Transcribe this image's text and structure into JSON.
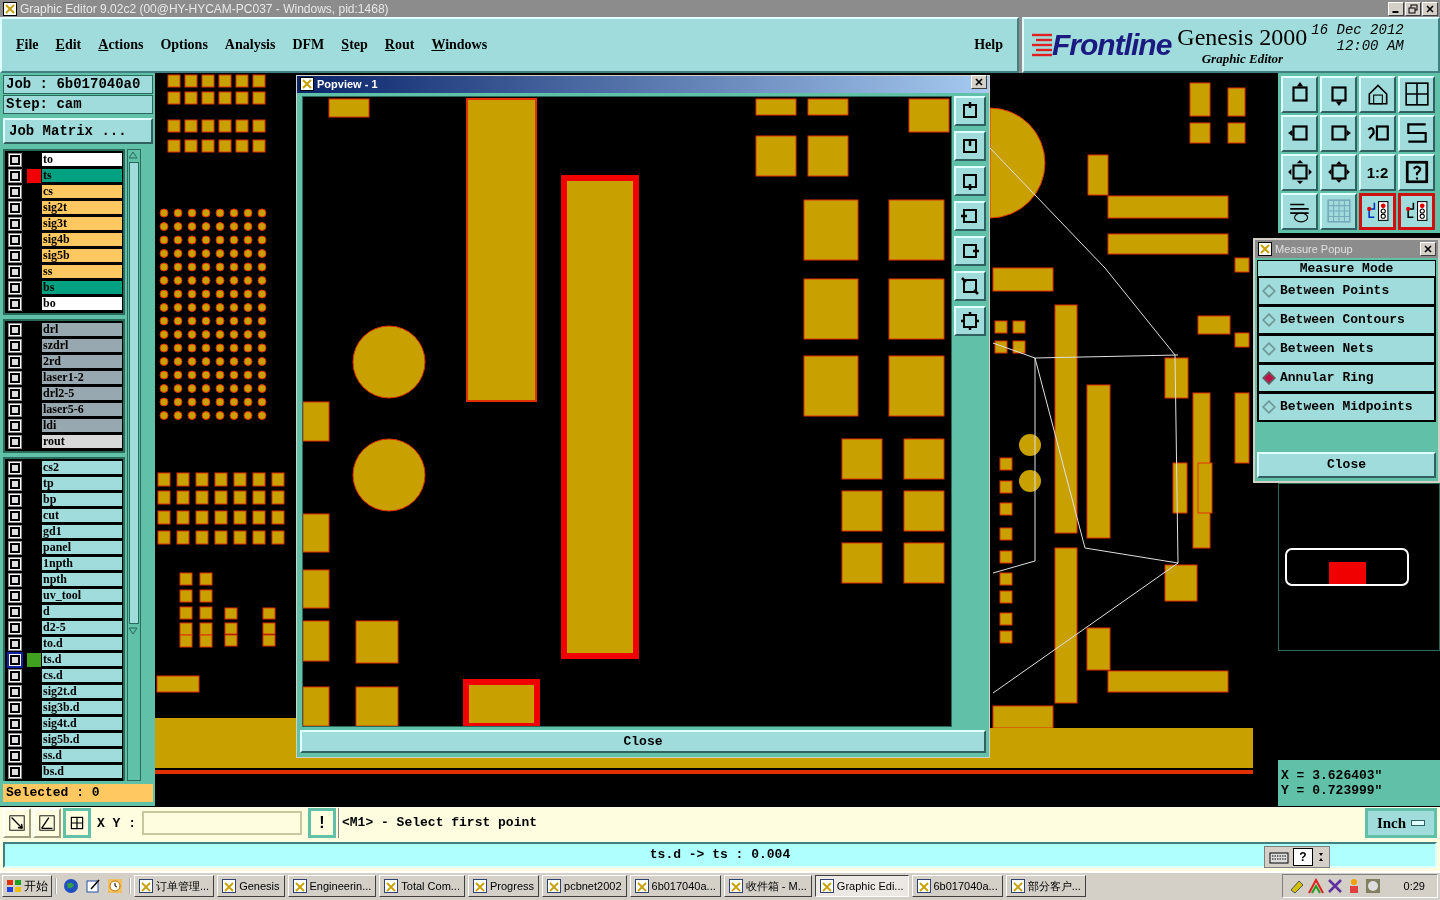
{
  "window": {
    "title": "Graphic Editor 9.02c2 (00@HY-HYCAM-PC037 - Windows, pid:1468)"
  },
  "menu": [
    {
      "label": "File",
      "mnemonic": true
    },
    {
      "label": "Edit",
      "mnemonic": true
    },
    {
      "label": "Actions",
      "mnemonic": true
    },
    {
      "label": "Options",
      "mnemonic": false
    },
    {
      "label": "Analysis",
      "mnemonic": false
    },
    {
      "label": "DFM",
      "mnemonic": false
    },
    {
      "label": "Step",
      "mnemonic": true
    },
    {
      "label": "Rout",
      "mnemonic": true
    },
    {
      "label": "Windows",
      "mnemonic": true
    }
  ],
  "help_menu": {
    "label": "Help",
    "mnemonic": false
  },
  "brand": {
    "logo": "Frontline",
    "product": "Genesis 2000",
    "subtitle": "Graphic Editor",
    "date": "16 Dec 2012",
    "time": "12:00 AM"
  },
  "job": {
    "job_label": "Job : 6b017040a0",
    "step_label": "Step: cam",
    "matrix_button": "Job Matrix ..."
  },
  "layer_groups": [
    {
      "layers": [
        {
          "name": "to",
          "color": "#ffffff",
          "work_layer": false,
          "displayed": false,
          "checked": false
        },
        {
          "name": "ts",
          "color": "#00a080",
          "work_layer": true,
          "displayed": false,
          "checked": false
        },
        {
          "name": "cs",
          "color": "#ffc860",
          "work_layer": false,
          "displayed": false,
          "checked": false
        },
        {
          "name": "sig2t",
          "color": "#ffc860",
          "work_layer": false,
          "displayed": false,
          "checked": false
        },
        {
          "name": "sig3t",
          "color": "#ffc860",
          "work_layer": false,
          "displayed": false,
          "checked": false
        },
        {
          "name": "sig4b",
          "color": "#ffc860",
          "work_layer": false,
          "displayed": false,
          "checked": false
        },
        {
          "name": "sig5b",
          "color": "#ffc860",
          "work_layer": false,
          "displayed": false,
          "checked": false
        },
        {
          "name": "ss",
          "color": "#ffc860",
          "work_layer": false,
          "displayed": false,
          "checked": false
        },
        {
          "name": "bs",
          "color": "#00a080",
          "work_layer": false,
          "displayed": false,
          "checked": false
        },
        {
          "name": "bo",
          "color": "#ffffff",
          "work_layer": false,
          "displayed": false,
          "checked": false
        }
      ]
    },
    {
      "layers": [
        {
          "name": "drl",
          "color": "#98a8b0",
          "work_layer": false,
          "displayed": false,
          "checked": false
        },
        {
          "name": "szdrl",
          "color": "#98a8b0",
          "work_layer": false,
          "displayed": false,
          "checked": false
        },
        {
          "name": "2rd",
          "color": "#98a8b0",
          "work_layer": false,
          "displayed": false,
          "checked": false
        },
        {
          "name": "laser1-2",
          "color": "#98a8b0",
          "work_layer": false,
          "displayed": false,
          "checked": false
        },
        {
          "name": "drl2-5",
          "color": "#98a8b0",
          "work_layer": false,
          "displayed": false,
          "checked": false
        },
        {
          "name": "laser5-6",
          "color": "#98a8b0",
          "work_layer": false,
          "displayed": false,
          "checked": false
        },
        {
          "name": "ldi",
          "color": "#98a8b0",
          "work_layer": false,
          "displayed": false,
          "checked": false
        },
        {
          "name": "rout",
          "color": "#d8d8d8",
          "work_layer": false,
          "displayed": false,
          "checked": false
        }
      ]
    },
    {
      "layers": [
        {
          "name": "cs2",
          "color": "#a0dcdc",
          "work_layer": false,
          "displayed": false,
          "checked": false
        },
        {
          "name": "tp",
          "color": "#a0dcdc",
          "work_layer": false,
          "displayed": false,
          "checked": false
        },
        {
          "name": "bp",
          "color": "#a0dcdc",
          "work_layer": false,
          "displayed": false,
          "checked": false
        },
        {
          "name": "cut",
          "color": "#a0dcdc",
          "work_layer": false,
          "displayed": false,
          "checked": false
        },
        {
          "name": "gd1",
          "color": "#a0dcdc",
          "work_layer": false,
          "displayed": false,
          "checked": false
        },
        {
          "name": "panel",
          "color": "#a0dcdc",
          "work_layer": false,
          "displayed": false,
          "checked": false
        },
        {
          "name": "1npth",
          "color": "#a0dcdc",
          "work_layer": false,
          "displayed": false,
          "checked": false
        },
        {
          "name": "npth",
          "color": "#a0dcdc",
          "work_layer": false,
          "displayed": false,
          "checked": false
        },
        {
          "name": "uv_tool",
          "color": "#a0dcdc",
          "work_layer": false,
          "displayed": false,
          "checked": false
        },
        {
          "name": "d",
          "color": "#a0dcdc",
          "work_layer": false,
          "displayed": false,
          "checked": false
        },
        {
          "name": "d2-5",
          "color": "#a0dcdc",
          "work_layer": false,
          "displayed": false,
          "checked": false
        },
        {
          "name": "to.d",
          "color": "#a0dcdc",
          "work_layer": false,
          "displayed": false,
          "checked": false
        },
        {
          "name": "ts.d",
          "color": "#a0dcdc",
          "work_layer": false,
          "displayed": true,
          "checked": true
        },
        {
          "name": "cs.d",
          "color": "#a0dcdc",
          "work_layer": false,
          "displayed": false,
          "checked": false
        },
        {
          "name": "sig2t.d",
          "color": "#a0dcdc",
          "work_layer": false,
          "displayed": false,
          "checked": false
        },
        {
          "name": "sig3b.d",
          "color": "#a0dcdc",
          "work_layer": false,
          "displayed": false,
          "checked": false
        },
        {
          "name": "sig4t.d",
          "color": "#a0dcdc",
          "work_layer": false,
          "displayed": false,
          "checked": false
        },
        {
          "name": "sig5b.d",
          "color": "#a0dcdc",
          "work_layer": false,
          "displayed": false,
          "checked": false
        },
        {
          "name": "ss.d",
          "color": "#a0dcdc",
          "work_layer": false,
          "displayed": false,
          "checked": false
        },
        {
          "name": "bs.d",
          "color": "#a0dcdc",
          "work_layer": false,
          "displayed": false,
          "checked": false
        }
      ]
    }
  ],
  "selected_count": "Selected : 0",
  "popview": {
    "title": "Popview - 1",
    "close_button": "Close"
  },
  "toolbar": {
    "ratio_label": "1:2"
  },
  "measure_popup": {
    "title": "Measure Popup",
    "heading": "Measure Mode",
    "options": [
      {
        "label": "Between Points",
        "selected": false
      },
      {
        "label": "Between Contours",
        "selected": false
      },
      {
        "label": "Between Nets",
        "selected": false
      },
      {
        "label": "Annular Ring",
        "selected": true
      },
      {
        "label": "Between Midpoints",
        "selected": false
      }
    ],
    "close_button": "Close"
  },
  "coordinates": {
    "x": "X = 3.626403\"",
    "y": "Y = 0.723999\""
  },
  "command_bar": {
    "xy_label": "X Y :",
    "alert_button": "!",
    "message": "<M1> - Select first point",
    "units_button": "Inch"
  },
  "status_bar": {
    "text": "ts.d -> ts : 0.004",
    "help_button": "?"
  },
  "taskbar": {
    "start": "开始",
    "tasks": [
      {
        "label": "订单管理...",
        "selected": false
      },
      {
        "label": "Genesis",
        "selected": false
      },
      {
        "label": "Engineerin...",
        "selected": false
      },
      {
        "label": "Total Com...",
        "selected": false
      },
      {
        "label": "Progress",
        "selected": false
      },
      {
        "label": "pcbnet2002",
        "selected": false
      },
      {
        "label": "6b017040a...",
        "selected": false
      },
      {
        "label": "收件箱 - M...",
        "selected": false
      },
      {
        "label": "Graphic Edi...",
        "selected": true
      },
      {
        "label": "6b017040a...",
        "selected": false
      },
      {
        "label": "部分客户...",
        "selected": false
      }
    ],
    "clock": "0:29"
  }
}
